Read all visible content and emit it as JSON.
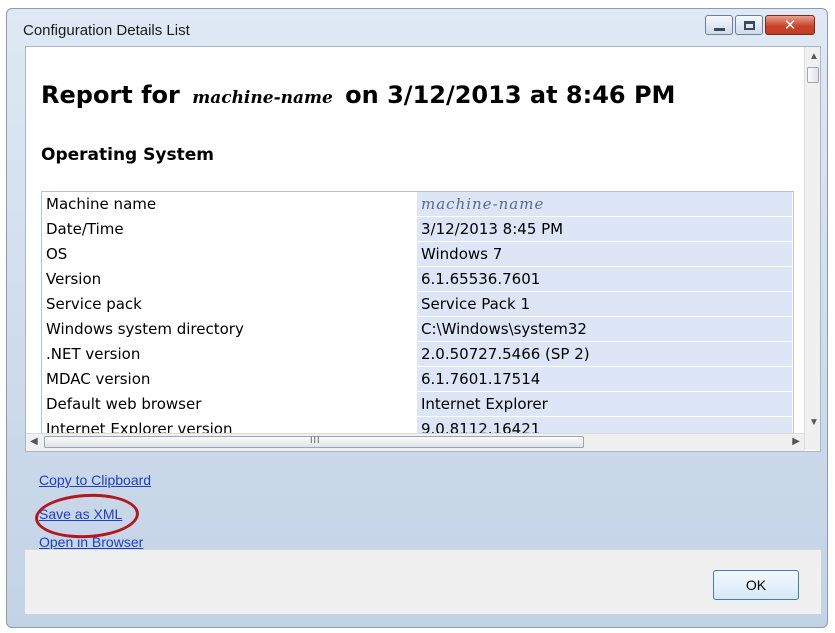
{
  "window": {
    "title": "Configuration Details List",
    "close_glyph": "✕"
  },
  "report": {
    "prefix": "Report for",
    "machine_name": "machine-name",
    "suffix": "on 3/12/2013 at 8:46 PM"
  },
  "section": {
    "heading": "Operating System",
    "rows": [
      {
        "key": "Machine name",
        "value": "machine-name"
      },
      {
        "key": "Date/Time",
        "value": "3/12/2013 8:45 PM"
      },
      {
        "key": "OS",
        "value": "Windows 7"
      },
      {
        "key": "Version",
        "value": "6.1.65536.7601"
      },
      {
        "key": "Service pack",
        "value": "Service Pack 1"
      },
      {
        "key": "Windows system directory",
        "value": "C:\\Windows\\system32"
      },
      {
        "key": ".NET version",
        "value": "2.0.50727.5466 (SP 2)"
      },
      {
        "key": "MDAC version",
        "value": "6.1.7601.17514"
      },
      {
        "key": "Default web browser",
        "value": "Internet Explorer"
      },
      {
        "key": "Internet Explorer version",
        "value": "9.0.8112.16421"
      }
    ]
  },
  "links": {
    "copy": "Copy to Clipboard",
    "save": "Save as XML",
    "open": "Open in Browser"
  },
  "footer": {
    "ok_label": "OK"
  },
  "colors": {
    "value_background": "#dde6f7",
    "link": "#1d3fbf",
    "highlight_circle": "#b3181f"
  },
  "scrollbar": {
    "grip": "III"
  }
}
